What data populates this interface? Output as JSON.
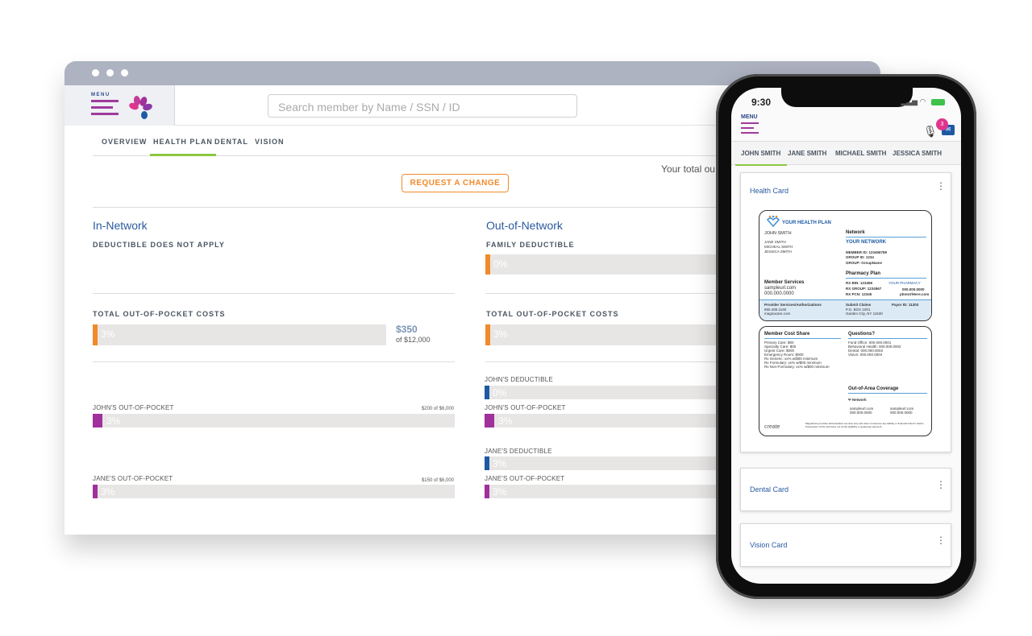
{
  "browser": {
    "menu_label": "MENU",
    "search_placeholder": "Search member by Name / SSN / ID",
    "tabs": [
      {
        "label": "OVERVIEW",
        "active": false
      },
      {
        "label": "HEALTH PLAN",
        "active": true
      },
      {
        "label": "DENTAL",
        "active": false
      },
      {
        "label": "VISION",
        "active": false
      }
    ],
    "total_text": "Your total ou",
    "request_change_label": "REQUEST A CHANGE",
    "in_network": {
      "title": "In-Network",
      "deductible_label": "DEDUCTIBLE DOES NOT APPLY",
      "total_oop_label": "TOTAL OUT-OF-POCKET COSTS",
      "total_oop_percent": "3%",
      "total_oop_amount": "$350",
      "total_oop_of": "of $12,000",
      "members": [
        {
          "label": "JOHN'S OUT-OF-POCKET",
          "amount": "$200 of $6,000",
          "percent": "3%"
        },
        {
          "label": "JANE'S OUT-OF-POCKET",
          "amount": "$150 of $6,000",
          "percent": "3%"
        }
      ]
    },
    "out_network": {
      "title": "Out-of-Network",
      "family_deductible_label": "FAMILY DEDUCTIBLE",
      "family_deductible_percent": "0%",
      "total_oop_label": "TOTAL OUT-OF-POCKET COSTS",
      "total_oop_percent": "3%",
      "members": [
        {
          "label": "JOHN'S DEDUCTIBLE",
          "percent": "0%"
        },
        {
          "label": "JOHN'S OUT-OF-POCKET",
          "percent": "3%"
        },
        {
          "label": "JANE'S DEDUCTIBLE",
          "percent": "3%"
        },
        {
          "label": "JANE'S OUT-OF-POCKET",
          "percent": "3%"
        }
      ]
    },
    "colors": {
      "orange": "#f18a2b",
      "purple": "#a0309c",
      "blue": "#1d5aa3",
      "green": "#8cc63f"
    }
  },
  "phone": {
    "time": "9:30",
    "menu_label": "MENU",
    "notification_count": "3",
    "member_tabs": [
      {
        "label": "JOHN SMITH",
        "active": true
      },
      {
        "label": "JANE SMITH",
        "active": false
      },
      {
        "label": "MICHAEL SMITH",
        "active": false
      },
      {
        "label": "JESSICA SMITH",
        "active": false
      }
    ],
    "cards": [
      {
        "title": "Health Card"
      },
      {
        "title": "Dental Card"
      },
      {
        "title": "Vision Card"
      }
    ],
    "id_card_front": {
      "plan_name": "YOUR HEALTH PLAN",
      "primary_member": "JOHN SMITH",
      "dependents": [
        "JANE SMITH",
        "MICHEAL SMITH",
        "JESSICA SMITH"
      ],
      "network_heading": "Network",
      "network_name": "YOUR NETWORK",
      "member_id": "MEMBER ID: 123456789",
      "group_id": "GROUP ID: 1234",
      "group": "GROUP: GroupName",
      "pharmacy_heading": "Pharmacy Plan",
      "rx_bin": "RX BIN: 123456",
      "rx_group": "RX GROUP: 1234567",
      "rx_pcn": "RX PCN: 12345",
      "pharmacy_name": "YOUR PHARMACY",
      "pharmacy_phone": "000.000.0000",
      "pharmacy_url": "pbmUrlHere.com",
      "member_services_heading": "Member Services",
      "member_services_url": "sampleurl.com",
      "member_services_phone": "000.000.0000",
      "provider_services_heading": "Provider Services/Authorizations",
      "provider_services_phone": "855.285.1160",
      "provider_services_url": "magnacare.com",
      "submit_claims_heading": "Submit Claims",
      "submit_claims_address1": "P.O. BOX 1001",
      "submit_claims_address2": "Garden City, NY 11530",
      "payor_id": "Payor ID: 11303"
    },
    "id_card_back": {
      "cost_share_heading": "Member Cost Share",
      "cost_share": [
        "Primary Care: $00",
        "Specialty Care: $00",
        "Urgent Care: $000",
        "Emergency Room: $000",
        "Rx Generic: xx% w/$00 minimum",
        "Rx Formulary: xx% w/$00 minimum",
        "Rx Non-Formulary: xx% w/$00 minimum"
      ],
      "questions_heading": "Questions?",
      "questions": [
        "Fund Office: 000.000.0001",
        "Behavioral Health: 000.000.0002",
        "Dental: 000.000.0003",
        "Vision: 000.000.0004"
      ],
      "ooa_heading": "Out-of-Area Coverage",
      "ooa_network": "Network",
      "ooa_contacts": [
        {
          "url": "sampleurl.com",
          "phone": "000.000.0000"
        },
        {
          "url": "sampleurl.com",
          "phone": "000.000.0000"
        }
      ],
      "brand": "create",
      "disclaimer": "MagnaCare provides administrative services only and does not assume any liability or financial risks for claims. Possession of this card does not certify eligibility or guarantee payment."
    }
  }
}
